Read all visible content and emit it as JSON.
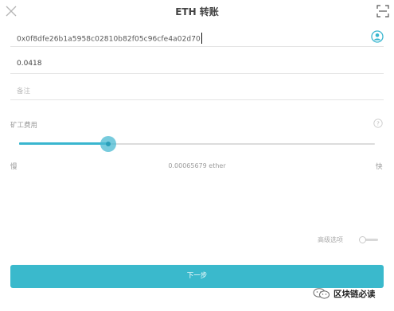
{
  "header": {
    "title": "ETH 转账",
    "close_icon": "close-icon",
    "scan_icon": "scan-icon"
  },
  "form": {
    "address_value": "0x0f8dfe26b1a5958c02810b82f05c96cfe4a02d70",
    "contact_icon": "contact-icon",
    "amount_value": "0.0418",
    "memo_placeholder": "备注"
  },
  "fee": {
    "label": "矿工费用",
    "help_icon": "question-icon",
    "slider_fraction": 0.25,
    "slow_label": "慢",
    "value_text": "0.00065679 ether",
    "fast_label": "快"
  },
  "advanced": {
    "label": "高级选项",
    "toggle_on": false
  },
  "actions": {
    "next_label": "下一步"
  },
  "watermark": {
    "text": "区块链必读"
  },
  "colors": {
    "accent": "#3ab9cc",
    "slider": "#39b6cf"
  }
}
